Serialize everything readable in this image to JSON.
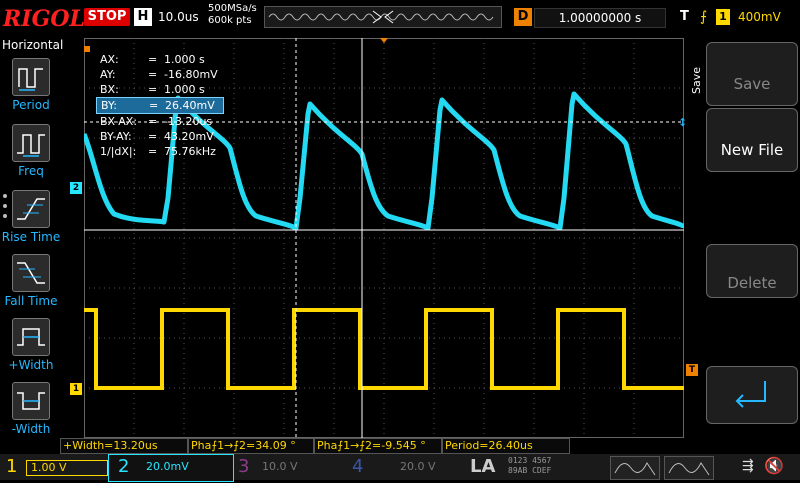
{
  "topbar": {
    "brand": "RIGOL",
    "run_state": "STOP",
    "timebase_badge": "H",
    "timebase": "10.0us",
    "sample_rate": "500MSa/s",
    "memory_depth": "600k pts",
    "delay_badge": "D",
    "delay": "1.00000000 s",
    "trigger_badge": "T",
    "trigger_edge": "⨍",
    "trigger_channel": "1",
    "trigger_level": "400mV"
  },
  "leftbar": {
    "title": "Horizontal",
    "items": [
      {
        "label": "Period",
        "icon": "period-icon"
      },
      {
        "label": "Freq",
        "icon": "frequency-icon"
      },
      {
        "label": "Rise Time",
        "icon": "rise-time-icon"
      },
      {
        "label": "Fall Time",
        "icon": "fall-time-icon"
      },
      {
        "label": "+Width",
        "icon": "positive-width-icon"
      },
      {
        "label": "-Width",
        "icon": "negative-width-icon"
      }
    ]
  },
  "rightbar": {
    "title": "Save",
    "buttons": [
      {
        "label": "Save",
        "enabled": false
      },
      {
        "label": "New File",
        "enabled": true
      },
      {
        "label": "Delete",
        "enabled": false
      },
      {
        "label": "",
        "icon": "enter-icon",
        "enabled": true
      }
    ]
  },
  "cursor": {
    "rows": [
      {
        "k": "AX:",
        "v": "1.000 s"
      },
      {
        "k": "AY:",
        "v": "-16.80mV"
      },
      {
        "k": "BX:",
        "v": "1.000 s"
      },
      {
        "k": "BY:",
        "v": "26.40mV",
        "highlight": true
      },
      {
        "k": "BX-AX:",
        "v": "-13.20us"
      },
      {
        "k": "BY-AY:",
        "v": "43.20mV"
      },
      {
        "k": "1/|dX|:",
        "v": "75.76kHz"
      }
    ],
    "eq": "="
  },
  "channel_markers": {
    "ch1": "1",
    "ch2": "2",
    "trig_ch": "T"
  },
  "measurements": [
    "+Width=13.20us",
    "Pha⨍1→⨍2=34.09 °",
    "Pha⨍1→⨍2=-9.545 °",
    "Period=26.40us"
  ],
  "channels": [
    {
      "num": "1",
      "scale": "1.00 V",
      "color": "#ffd800",
      "active": true
    },
    {
      "num": "2",
      "scale": "20.0mV",
      "color": "#26e6ff",
      "active": true
    },
    {
      "num": "3",
      "scale": "10.0 V",
      "color": "#c020c0",
      "active": false
    },
    {
      "num": "4",
      "scale": "20.0 V",
      "color": "#2a4fff",
      "active": false
    }
  ],
  "la": {
    "label": "LA",
    "digits": [
      "0123",
      "4567",
      "89AB",
      "CDEF"
    ]
  },
  "colors": {
    "ch1": "#ffd800",
    "ch2": "#26e6ff",
    "accent": "#26b8ff",
    "stop": "#d00000"
  }
}
